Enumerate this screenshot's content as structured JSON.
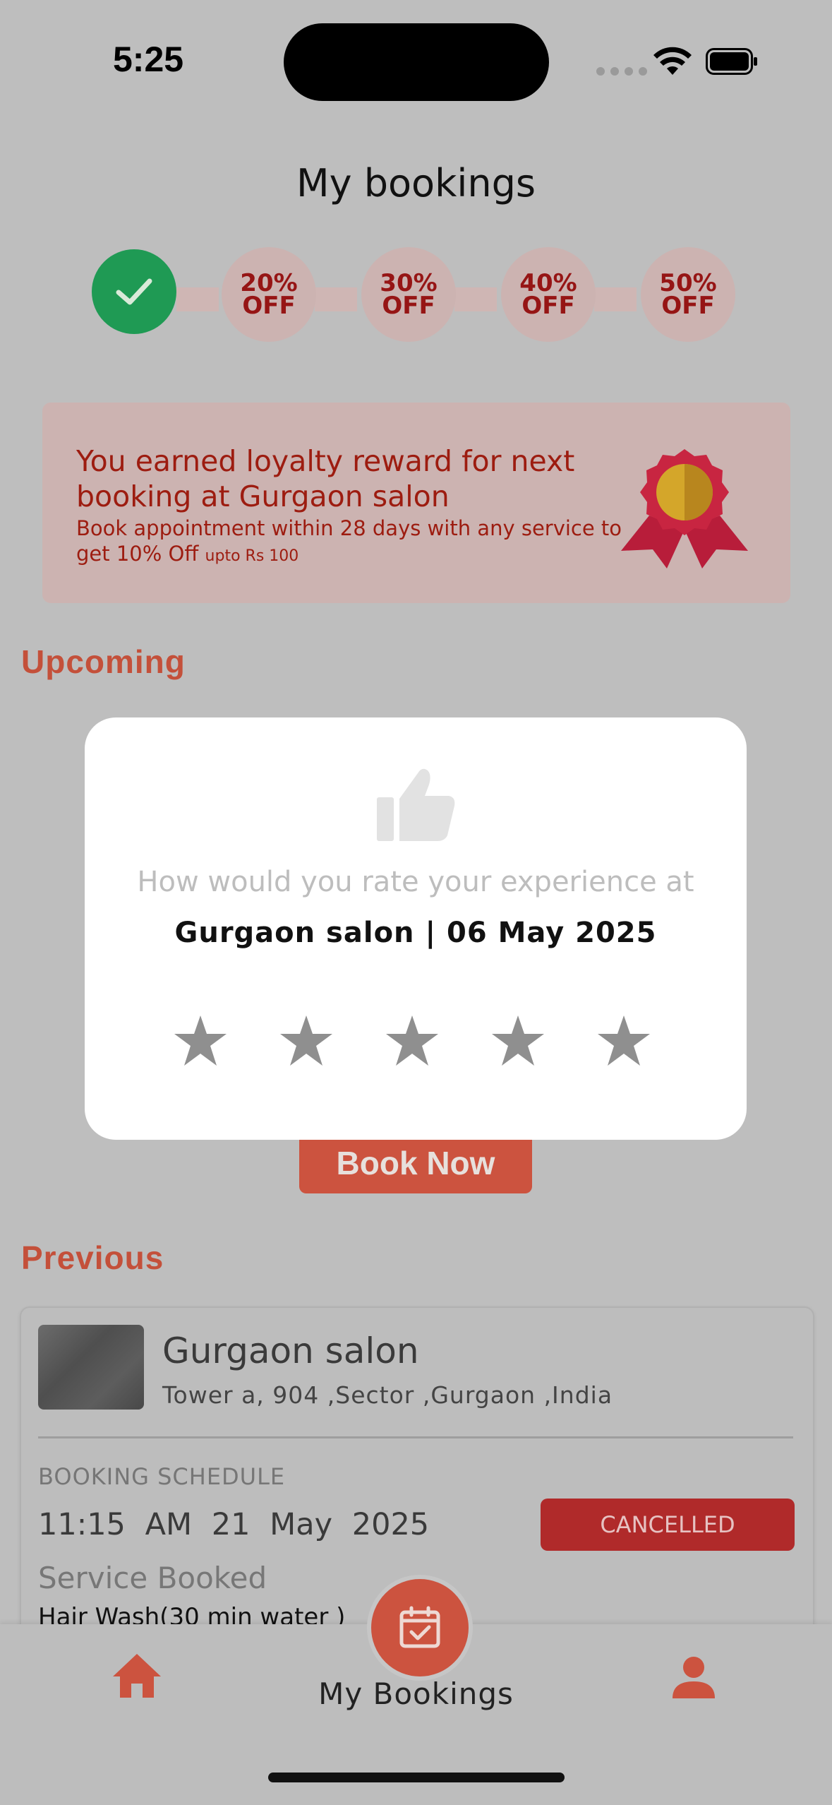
{
  "status_bar": {
    "time": "5:25"
  },
  "header": {
    "title": "My bookings"
  },
  "loyalty_track": {
    "completed_steps": 1,
    "steps": [
      {
        "line1": "",
        "line2": ""
      },
      {
        "line1": "20%",
        "line2": "OFF"
      },
      {
        "line1": "30%",
        "line2": "OFF"
      },
      {
        "line1": "40%",
        "line2": "OFF"
      },
      {
        "line1": "50%",
        "line2": "OFF"
      }
    ]
  },
  "reward": {
    "title": "You earned loyalty reward for next booking at Gurgaon salon",
    "subtitle": "Book appointment within 28 days with any service to get 10% Off",
    "subtitle_small": "upto Rs 100"
  },
  "sections": {
    "upcoming": "Upcoming",
    "previous": "Previous"
  },
  "rating_modal": {
    "question": "How would you rate your experience at",
    "venue": "Gurgaon salon | 06 May 2025",
    "stars_total": 5,
    "stars_selected": 0
  },
  "book_now": {
    "label": "Book Now"
  },
  "previous_booking": {
    "salon_name": "Gurgaon salon",
    "address": "Tower a, 904 ,Sector  ,Gurgaon  ,India",
    "schedule_label": "BOOKING SCHEDULE",
    "time": "11:15 AM",
    "date": "21 May 2025",
    "status": "CANCELLED",
    "service_label": "Service Booked",
    "service": "Hair Wash(30 min water )"
  },
  "bottom_nav": {
    "center_label": "My Bookings"
  },
  "colors": {
    "accent": "#cc533f",
    "success": "#1f9a54",
    "cancelled": "#b02a2a",
    "reward_text": "#9d1c10"
  }
}
